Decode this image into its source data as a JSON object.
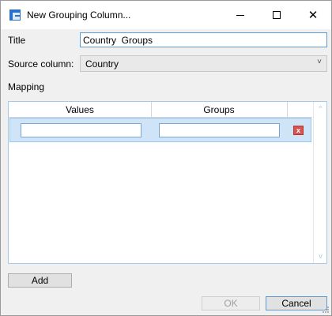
{
  "window": {
    "title": "New Grouping Column...",
    "controls": [
      "minimize-icon",
      "maximize-icon",
      "close-icon"
    ],
    "close_glyph": "✕"
  },
  "form": {
    "title_label": "Title",
    "title_value": "Country  Groups",
    "source_label": "Source column:",
    "source_value": "Country",
    "mapping_label": "Mapping"
  },
  "mapping_table": {
    "columns": [
      "Values",
      "Groups"
    ],
    "rows": [
      {
        "value": "",
        "group": "",
        "delete_glyph": "x"
      }
    ],
    "scroll_up_glyph": "^",
    "scroll_down_glyph": "v"
  },
  "buttons": {
    "add": "Add",
    "ok": "OK",
    "cancel": "Cancel"
  },
  "colors": {
    "accent": "#5b9bd5",
    "selected_row": "#cfe4f7",
    "delete": "#d9534f"
  }
}
